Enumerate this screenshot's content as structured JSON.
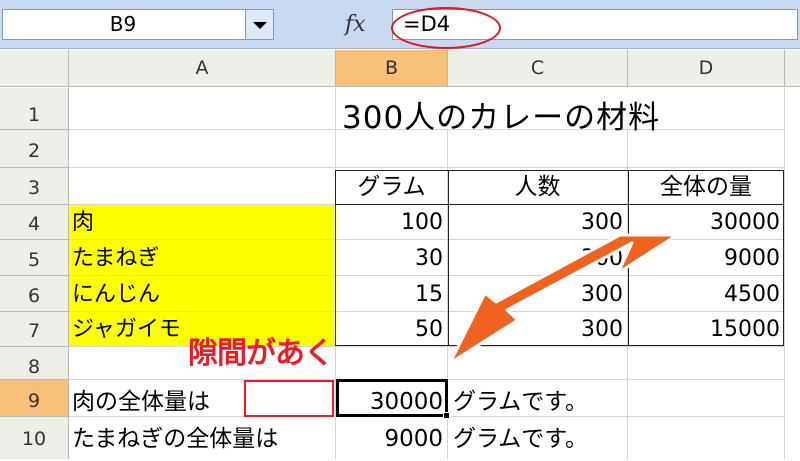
{
  "formula_bar": {
    "name_box": "B9",
    "fx_label": "fx",
    "formula": "=D4"
  },
  "columns": [
    "A",
    "B",
    "C",
    "D"
  ],
  "rows": [
    "1",
    "2",
    "3",
    "4",
    "5",
    "6",
    "7",
    "8",
    "9",
    "10"
  ],
  "title": "300人のカレーの材料",
  "table": {
    "headers": [
      "グラム",
      "人数",
      "全体の量"
    ],
    "rows": [
      {
        "name": "肉",
        "gram": "100",
        "people": "300",
        "total": "30000"
      },
      {
        "name": "たまねぎ",
        "gram": "30",
        "people": "300",
        "total": "9000"
      },
      {
        "name": "にんじん",
        "gram": "15",
        "people": "300",
        "total": "4500"
      },
      {
        "name": "ジャガイモ",
        "gram": "50",
        "people": "300",
        "total": "15000"
      }
    ]
  },
  "results": [
    {
      "label": "肉の全体量は",
      "value": "30000",
      "suffix": "グラムです。"
    },
    {
      "label": "たまねぎの全体量は",
      "value": "9000",
      "suffix": "グラムです。"
    }
  ],
  "annotation": {
    "text": "隙間があく",
    "color": "#ee1b24"
  },
  "arrow_color": "#f0621f",
  "highlight_color": "#e8141b"
}
